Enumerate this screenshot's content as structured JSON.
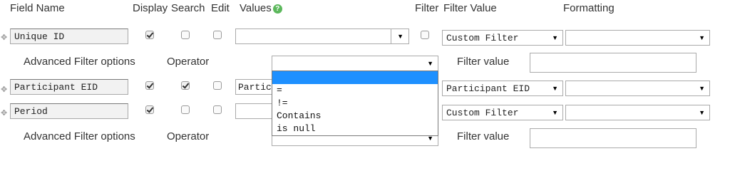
{
  "headers": {
    "field_name": "Field Name",
    "display": "Display",
    "search": "Search",
    "edit": "Edit",
    "values": "Values",
    "filter": "Filter",
    "filter_value": "Filter Value",
    "formatting": "Formatting"
  },
  "icons": {
    "help": "question-circle-icon",
    "move": "move-arrows-icon",
    "dropdown": "chevron-down-icon"
  },
  "colors": {
    "help_icon": "#5cb85c",
    "highlight": "#1e90ff"
  },
  "rows": [
    {
      "field_name": "Unique ID",
      "display": true,
      "search": false,
      "edit": false,
      "values": "",
      "filter": false,
      "filter_value": "Custom Filter",
      "formatting": ""
    },
    {
      "field_name": "Participant EID",
      "display": true,
      "search": true,
      "edit": false,
      "values": "Partic",
      "filter_value": "Participant EID",
      "formatting": ""
    },
    {
      "field_name": "Period",
      "display": true,
      "search": false,
      "edit": false,
      "values": "",
      "filter_value": "Custom Filter",
      "formatting": ""
    }
  ],
  "advanced": [
    {
      "label": "Advanced Filter options",
      "operator_label": "Operator",
      "operator_value": "",
      "filter_value_label": "Filter value",
      "filter_value": ""
    },
    {
      "label": "Advanced Filter options",
      "operator_label": "Operator",
      "filter_value_label": "Filter value",
      "filter_value": ""
    }
  ],
  "operator_options": [
    "",
    "=",
    "!=",
    "Contains",
    "is null"
  ]
}
